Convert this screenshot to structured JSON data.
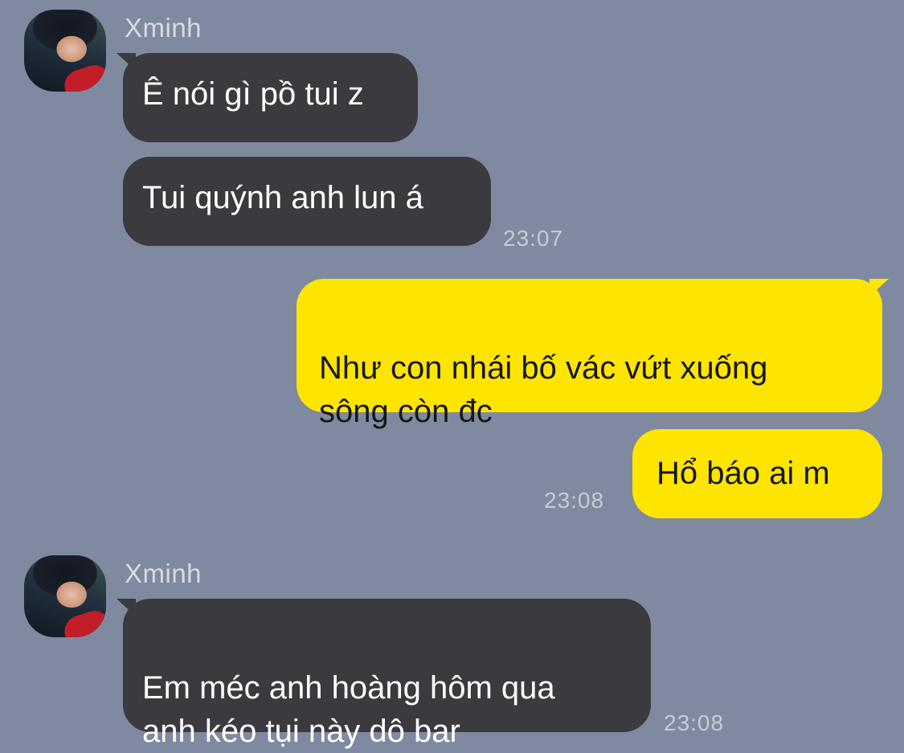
{
  "chat": {
    "messages": [
      {
        "sender": "Xminh",
        "text": "Ê nói gì pồ tui z"
      },
      {
        "text": "Tui quýnh anh lun á",
        "time": "23:07"
      },
      {
        "text": "Như con nhái bố vác vứt xuống\nsông còn đc"
      },
      {
        "text": "Hổ báo ai m",
        "time": "23:08"
      },
      {
        "sender": "Xminh",
        "text": "Em méc anh hoàng hôm qua\nanh kéo tụi này dô bar",
        "time": "23:08"
      }
    ]
  },
  "colors": {
    "background": "#7f8aa0",
    "incoming_bubble": "#3a3a3f",
    "outgoing_bubble": "#fee500"
  },
  "icons": {
    "avatar": "profile-photo"
  }
}
